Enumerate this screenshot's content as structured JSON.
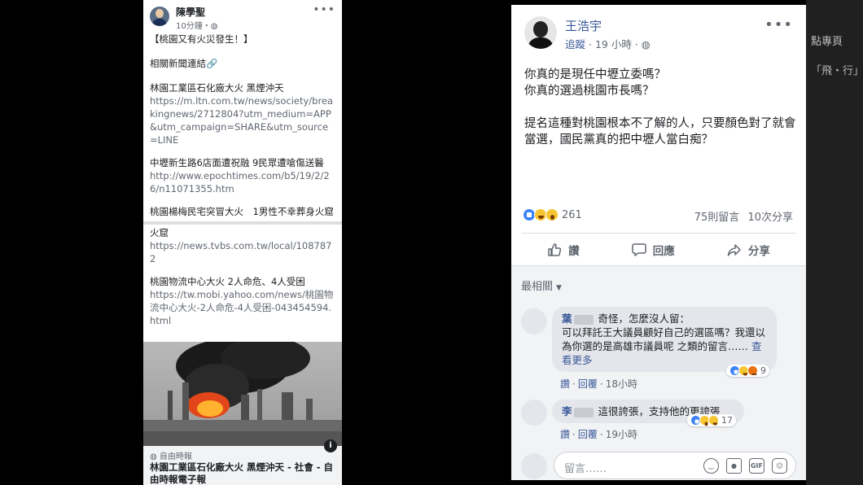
{
  "background": {
    "right_texts": [
      "點專頁",
      "「飛・行」"
    ]
  },
  "left_post": {
    "author": "陳學聖",
    "meta": "10分鐘・",
    "text_intro": "【桃園又有火災發生！】",
    "related_label": "相關新聞連結🔗",
    "links": [
      {
        "title": "林園工業區石化廠大火 黑煙沖天",
        "url": "https://m.ltn.com.tw/news/society/breakingnews/2712804?utm_medium=APP&utm_campaign=SHARE&utm_source=LINE"
      },
      {
        "title": "中壢新生路6店面遭祝融 9民眾遭嗆傷送醫",
        "url": "http://www.epochtimes.com/b5/19/2/26/n11071355.htm"
      },
      {
        "title": "桃園楊梅民宅突冒大火　1男性不幸葬身火窟",
        "url": "https://news.tvbs.com.tw/local/1087872"
      },
      {
        "title": "桃園物流中心大火 2人命危、4人受困",
        "url": "https://tw.mobi.yahoo.com/news/桃園物流中心大火-2人命危-4人受困-043454594.html"
      }
    ],
    "card": {
      "source": "自由時報",
      "title": "林園工業區石化廠大火 黑煙沖天 - 社會 - 自由時報電子報",
      "info_icon": "i"
    }
  },
  "right_post": {
    "author": "王浩宇",
    "follow_label": "追蹤",
    "time": "19 小時",
    "body": [
      "你真的是現任中壢立委嗎？",
      "你真的選過桃園市長嗎？",
      "",
      "提名這種對桃園根本不了解的人，只要顏色對了就會當選，國民黨真的把中壢人當白痴？"
    ],
    "reaction_count": "261",
    "comment_count": "75則留言",
    "share_count": "10次分享",
    "actions": {
      "like": "讚",
      "comment": "回應",
      "share": "分享"
    },
    "sort_label": "最相關",
    "comments": [
      {
        "author": "葉",
        "text_first": "奇怪，怎麼沒人留：",
        "text_rest": "可以拜託王大議員顧好自己的選區嗎？我還以為你選的是高雄市議員呢 之類的留言……",
        "see_more": "查看更多",
        "like": "讚",
        "reply": "回覆",
        "time": "18小時",
        "reactions": "9"
      },
      {
        "author": "李",
        "text_first": "這很誇張，支持他的更誇張",
        "like": "讚",
        "reply": "回覆",
        "time": "19小時",
        "reactions": "17"
      }
    ],
    "composer_placeholder": "留言……",
    "composer_gif": "GIF"
  }
}
